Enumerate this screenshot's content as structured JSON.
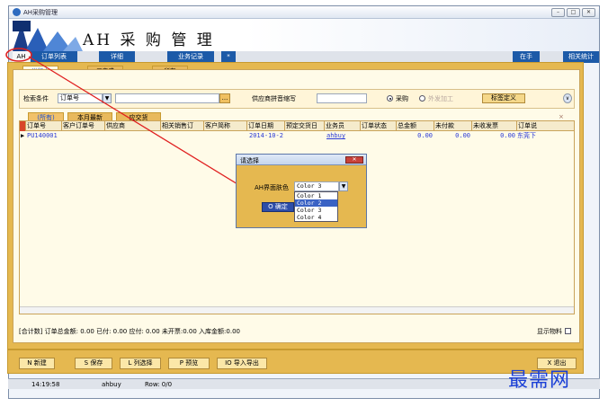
{
  "window": {
    "title": "AH采购管理",
    "min": "–",
    "max": "□",
    "close": "✕"
  },
  "app": {
    "title": "AH 采 购 管 理"
  },
  "menubar": {
    "ah": "AH",
    "tabs": [
      "订单列表",
      "详细",
      "业务记录",
      "*"
    ],
    "right": [
      "在手",
      "相关统计"
    ]
  },
  "subtabs": [
    "进行中",
    "已完成",
    "所有"
  ],
  "filter": {
    "search_label": "检索条件",
    "search_field": "订单号",
    "search_value": "",
    "ellipsis": "...",
    "supplier_label": "供应商拼音缩写",
    "supplier_value": "",
    "radio_purchase": "采购",
    "radio_outsource": "外发加工",
    "tag_button": "标签定义",
    "collapse": "∨"
  },
  "grid": {
    "tabs": [
      "(所有)",
      "本月最新",
      "应交货"
    ],
    "close": "×",
    "columns": [
      "订单号",
      "客户订单号",
      "供应商",
      "相关销售订",
      "客户简称",
      "订单日期",
      "预定交货日",
      "业务员",
      "订单状态",
      "总金额",
      "未付款",
      "未收发票",
      "订单说"
    ],
    "rows": [
      {
        "order_no": "PU140001",
        "date": "2014-10-2",
        "clerk": "ahbuy",
        "total": "0.00",
        "unpaid": "0.00",
        "uninvoiced": "0.00",
        "note": "东莞下"
      }
    ]
  },
  "summary": {
    "text": "[合计数] 订单总金额: 0.00   已付: 0.00   应付: 0.00   未开票:0.00   入库金额:0.00",
    "show_material": "显示物料"
  },
  "buttons": [
    "N 新建",
    "S 保存",
    "L 列选择",
    "P 预览",
    "IO 导入导出",
    "X 退出"
  ],
  "status": {
    "time": "14:19:58",
    "user": "ahbuy",
    "row": "Row: 0/0"
  },
  "dialog": {
    "title": "请选择",
    "label": "AH界面肤色",
    "selected": "Color 3",
    "options": [
      "Color 1",
      "Color 2",
      "Color 3",
      "Color 4"
    ],
    "confirm": "O 确定"
  },
  "watermark": "最需网",
  "colors": {
    "accent": "#1c5aa8",
    "panel": "#e5b850",
    "arrow": "#e02020"
  }
}
